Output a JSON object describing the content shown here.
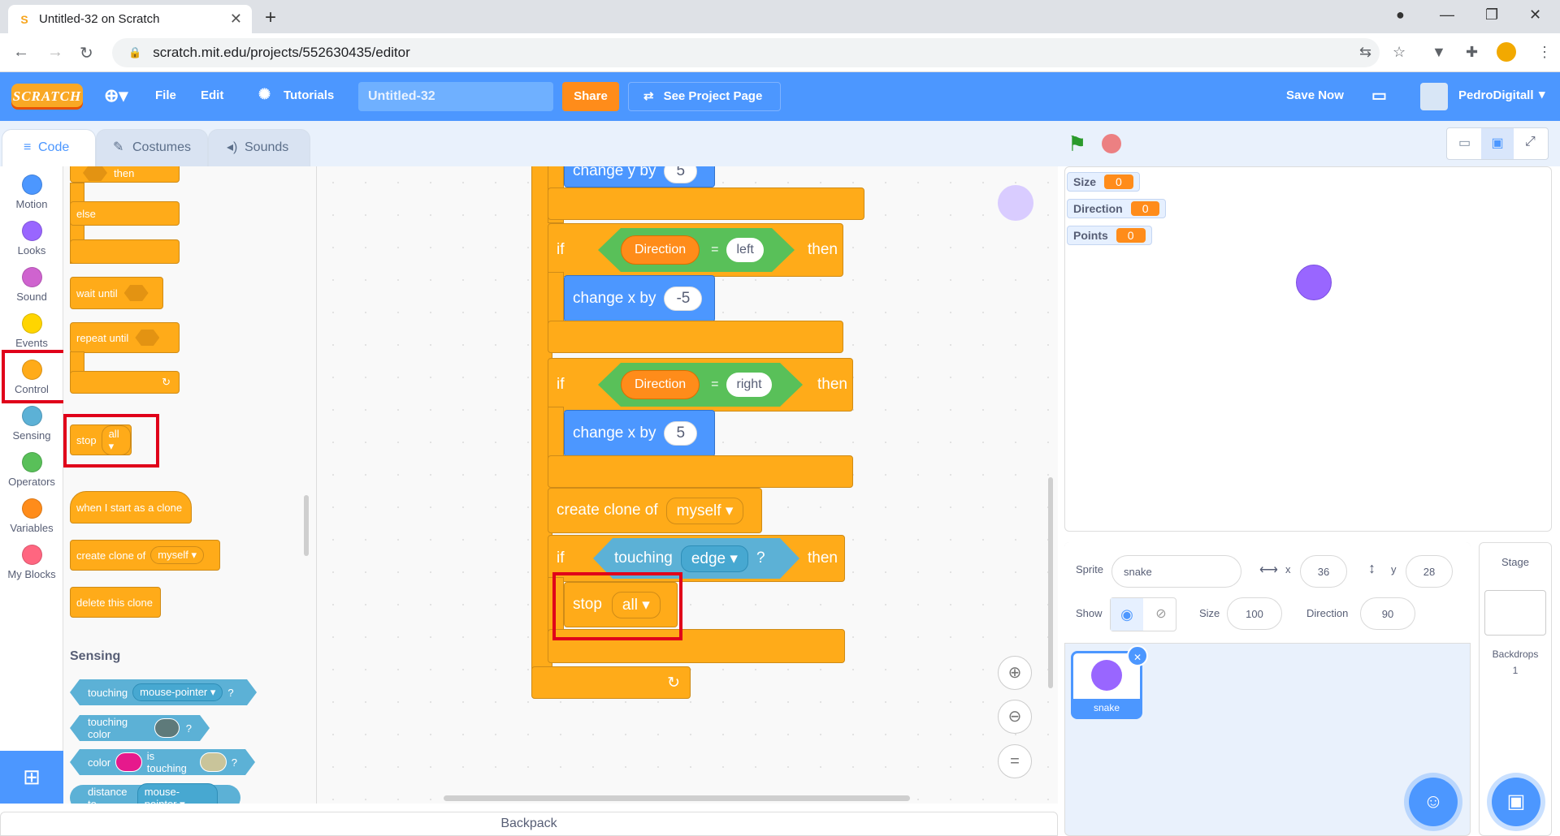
{
  "browser": {
    "tab_title": "Untitled-32 on Scratch",
    "url": "scratch.mit.edu/projects/552630435/editor"
  },
  "menubar": {
    "logo": "SCRATCH",
    "file": "File",
    "edit": "Edit",
    "tutorials": "Tutorials",
    "project_title": "Untitled-32",
    "share": "Share",
    "see_project_page": "See Project Page",
    "save_now": "Save Now",
    "username": "PedroDigitall"
  },
  "editor_tabs": [
    "Code",
    "Costumes",
    "Sounds"
  ],
  "categories": [
    "Motion",
    "Looks",
    "Sound",
    "Events",
    "Control",
    "Sensing",
    "Operators",
    "Variables",
    "My Blocks"
  ],
  "category_colors": [
    "#4c97ff",
    "#9966ff",
    "#cf63cf",
    "#ffd500",
    "#ffab19",
    "#5cb1d6",
    "#59c059",
    "#ff8c1a",
    "#ff6680"
  ],
  "palette": {
    "if_then_top": "then",
    "else": "else",
    "wait_until": "wait until",
    "repeat_until": "repeat until",
    "stop": "stop",
    "stop_option": "all",
    "when_clone": "when I start as a clone",
    "create_clone": "create clone of",
    "create_clone_option": "myself",
    "delete_clone": "delete this clone",
    "sensing_title": "Sensing",
    "touching": "touching",
    "touching_option": "mouse-pointer",
    "touching_color": "touching color",
    "color": "color",
    "is_touching": "is touching",
    "distance_to": "distance to",
    "distance_option": "mouse-pointer",
    "question": "?"
  },
  "script": {
    "change_y": "change y by",
    "change_y_value": "5",
    "if1_if": "if",
    "if1_var": "Direction",
    "if1_op": "=",
    "if1_value": "left",
    "if1_then": "then",
    "change_x1": "change x by",
    "change_x1_value": "-5",
    "if2_if": "if",
    "if2_var": "Direction",
    "if2_op": "=",
    "if2_value": "right",
    "if2_then": "then",
    "change_x2": "change x by",
    "change_x2_value": "5",
    "create_clone": "create clone of",
    "create_clone_option": "myself",
    "if3_if": "if",
    "if3_touching": "touching",
    "if3_option": "edge",
    "if3_question": "?",
    "if3_then": "then",
    "stop": "stop",
    "stop_option": "all",
    "loop_arrow": "↻"
  },
  "backpack": "Backpack",
  "monitors": [
    {
      "label": "Size",
      "value": "0"
    },
    {
      "label": "Direction",
      "value": "0"
    },
    {
      "label": "Points",
      "value": "0"
    }
  ],
  "sprite_info": {
    "sprite_label": "Sprite",
    "sprite_name": "snake",
    "x_label": "x",
    "x_value": "36",
    "y_label": "y",
    "y_value": "28",
    "show_label": "Show",
    "size_label": "Size",
    "size_value": "100",
    "direction_label": "Direction",
    "direction_value": "90"
  },
  "sprites": [
    {
      "name": "snake"
    }
  ],
  "stage_panel": {
    "title": "Stage",
    "backdrops_label": "Backdrops",
    "backdrops_count": "1"
  }
}
